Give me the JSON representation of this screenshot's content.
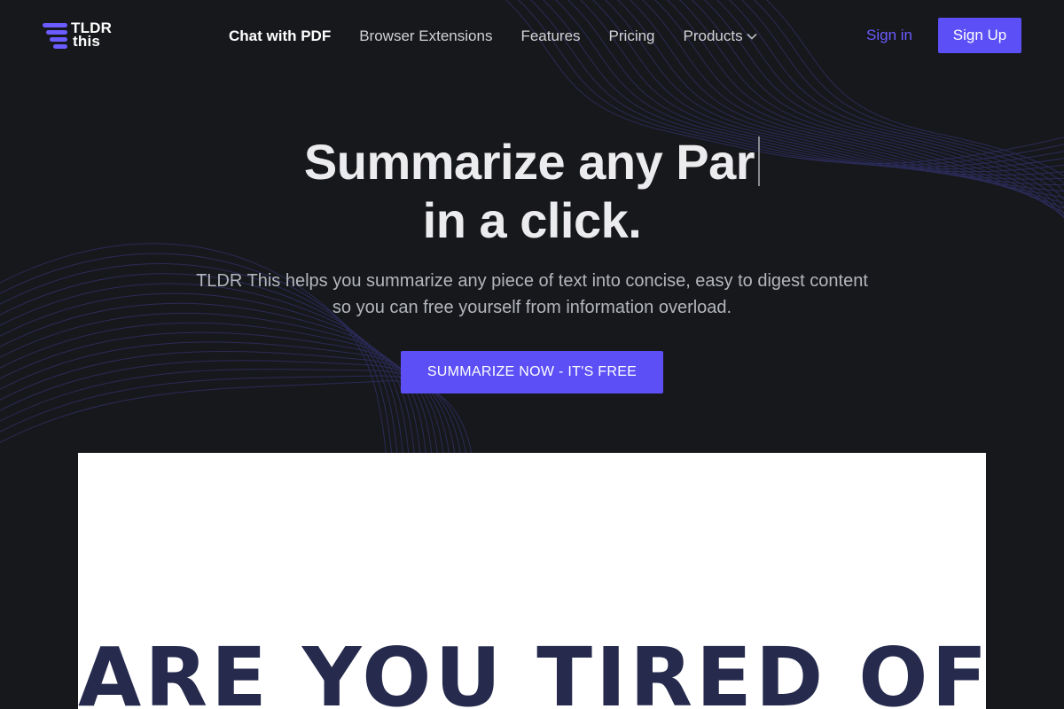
{
  "logo": {
    "line1": "TLDR",
    "line2": "this",
    "icon": "stacked-bars-logo-icon"
  },
  "nav": {
    "items": [
      {
        "label": "Chat with PDF",
        "active": true
      },
      {
        "label": "Browser Extensions",
        "active": false
      },
      {
        "label": "Features",
        "active": false
      },
      {
        "label": "Pricing",
        "active": false
      },
      {
        "label": "Products",
        "active": false,
        "icon": "chevron-down-icon"
      }
    ],
    "signin": "Sign in",
    "signup": "Sign Up"
  },
  "hero": {
    "title_line1": "Summarize any Par",
    "title_line2": "in a click.",
    "subtitle": "TLDR This helps you summarize any piece of text into concise, easy to digest content so you can free yourself from information overload.",
    "cta": "SUMMARIZE NOW - IT'S FREE"
  },
  "video": {
    "headline": "ARE YOU TIRED OF"
  },
  "colors": {
    "background": "#17181b",
    "accent": "#5b4ff5",
    "signin": "#6a5cff",
    "video_text": "#262a4d"
  }
}
